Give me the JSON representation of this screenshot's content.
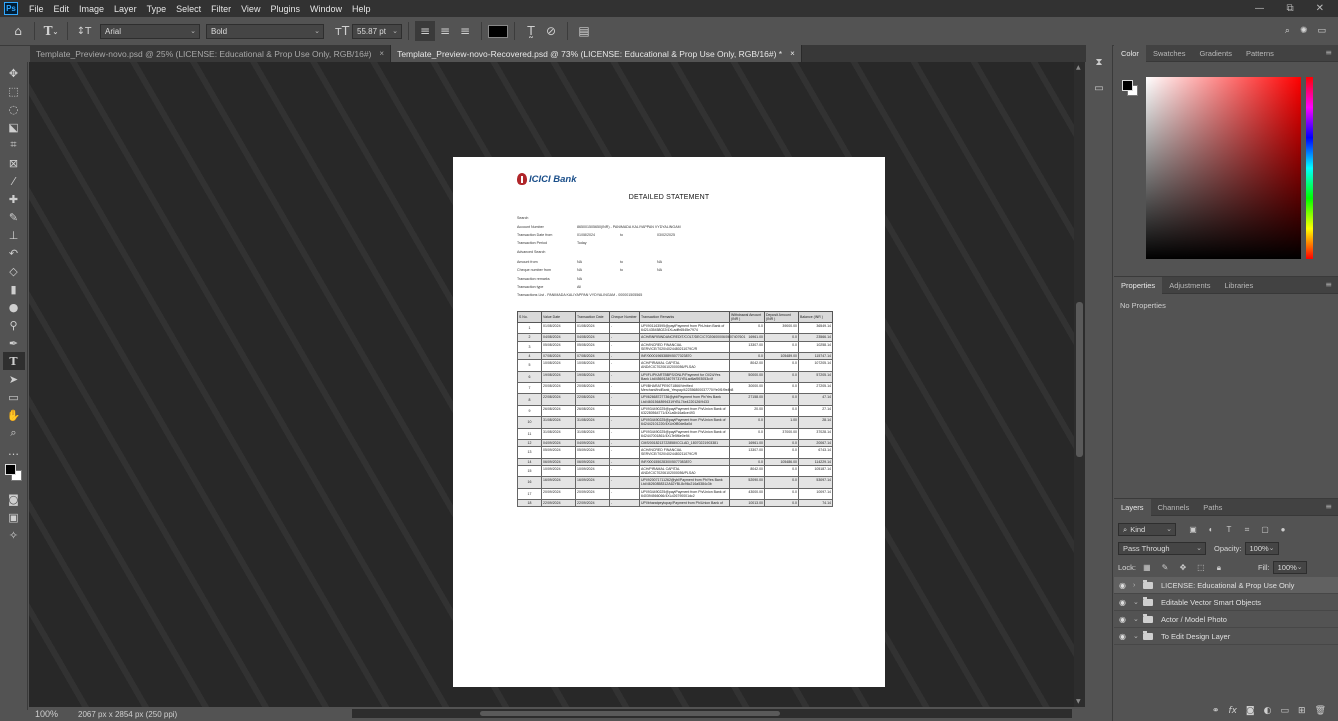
{
  "app": {
    "logo": "Ps"
  },
  "menu": [
    "File",
    "Edit",
    "Image",
    "Layer",
    "Type",
    "Select",
    "Filter",
    "View",
    "Plugins",
    "Window",
    "Help"
  ],
  "window_controls": {
    "minimize": "—",
    "restore": "⧉",
    "close": "✕"
  },
  "options": {
    "font_family": "Arial",
    "font_style": "Bold",
    "font_size": "55.87 pt",
    "text_color": "#000000"
  },
  "tabs": [
    {
      "label": "Template_Preview-novo.psd @ 25% (LICENSE: Educational & Prop Use Only, RGB/16#)",
      "close": "×"
    },
    {
      "label": "Template_Preview-novo-Recovered.psd @ 73% (LICENSE: Educational & Prop Use Only, RGB/16#) *",
      "close": "×"
    }
  ],
  "status": {
    "zoom": "100%",
    "doc_info": "2067 px x 2854 px (250 ppi)"
  },
  "document": {
    "bank_name": "ICICI Bank",
    "title": "DETAILED STATEMENT",
    "info_rows": [
      {
        "label": "Search",
        "value": "",
        "mid": "",
        "value2": ""
      },
      {
        "label": "Account Number",
        "value": "865001505650(INR) - PANIMADA KALIYAPPAN VYDYALINGAM",
        "mid": "",
        "value2": ""
      },
      {
        "label": "Transaction Date from",
        "value": "01/08/2024",
        "mid": "to",
        "value2": "03/02/2025"
      },
      {
        "label": "Transaction Period",
        "value": "Today",
        "mid": "",
        "value2": ""
      },
      {
        "label": "Advanced Search",
        "value": "",
        "mid": "",
        "value2": ""
      },
      {
        "label": "Amount from",
        "value": "NA",
        "mid": "to",
        "value2": "NA"
      },
      {
        "label": "Cheque number from",
        "value": "NA",
        "mid": "to",
        "value2": "NA"
      },
      {
        "label": "Transaction remarks",
        "value": "NA",
        "mid": "",
        "value2": ""
      },
      {
        "label": "Transaction type",
        "value": "All",
        "mid": "",
        "value2": ""
      },
      {
        "label": "Transactions List - PANIMADA KALIYAPPAN VYDYALINGAM - 000001505565",
        "value": "",
        "mid": "",
        "value2": ""
      }
    ],
    "table_headers": [
      "S No.",
      "Value Date",
      "Transaction Date",
      "Cheque Number",
      "Transaction Remarks",
      "Withdrawal Amount (INR )",
      "Deposit Amount (INR )",
      "Balance (INR )"
    ],
    "rows": [
      [
        "1",
        "01/08/2024",
        "01/08/2024",
        "-",
        "UPI/901163595@paytPayment from PhUnion Bank of 6421435458022/4XLadfb6545e7974",
        "0.0",
        "39000.00",
        "36549.14"
      ],
      [
        "2",
        "04/08/2024",
        "04/08/2024",
        "-",
        "ACH/BNFIBINDANCREDIT/COLT/DEC/C7020600006/0607407601",
        "16961.00",
        "0.0",
        "23566.14"
      ],
      [
        "3",
        "05/08/2024",
        "05/08/2024",
        "-",
        "ACH/INCRED FINANCIAL SERVICE/7020/4024480211079C/R",
        "13307.00",
        "0.0",
        "10258.14"
      ],
      [
        "4",
        "07/08/2024",
        "07/08/2024",
        "-",
        "INF/000019653889/5077023870",
        "0.0",
        "105489.00",
        "115747.14"
      ],
      [
        "5",
        "10/08/2024",
        "10/08/2024",
        "-",
        "ACH/PIRAMAL CAPITAL AND/ICIC70206102000056/PLSA0",
        "8042.00",
        "0.0",
        "107205.14"
      ],
      [
        "6",
        "19/08/2024",
        "19/08/2024",
        "-",
        "UPI/FLIPKARTBBPS/ONLP/Payment for OI/24/Yes Bank Ltd/4569134079731YBLad6af593053c4f",
        "50000.00",
        "0.0",
        "57205.14"
      ],
      [
        "7",
        "20/08/2024",
        "20/08/2024",
        "-",
        "UPI/BHARATPE9071866/Verified Merchant/IndBank_Yespay/422356800037770/Ye0f1f9e4b8",
        "30000.00",
        "0.0",
        "27205.14"
      ],
      [
        "8",
        "22/08/2024",
        "22/08/2024",
        "-",
        "UPI/62668727736@ybl/Payment from Ph/Yes Bank Ltd/46015648994319YBL74e4220126/9433",
        "27158.00",
        "0.0",
        "47.14"
      ],
      [
        "9",
        "26/08/2024",
        "26/08/2024",
        "-",
        "UPI/934490225@paytPayment from Ph/Union Bank of 632280564771/4XLa6b16a6ce493",
        "20.00",
        "0.0",
        "27.14"
      ],
      [
        "10",
        "31/08/2024",
        "31/08/2024",
        "-",
        "UPI/934490225@paytPayment from Ph/Union Bank of 642442101220/4XLb0f80de8a0d",
        "0.0",
        "1.00",
        "28.14"
      ],
      [
        "11",
        "31/08/2024",
        "31/08/2024",
        "-",
        "UPI/934490225@paytPayment from Ph/Union Bank of 642447001861/4XLTe5f6e0e94",
        "0.0",
        "37000.00",
        "37028.14"
      ],
      [
        "12",
        "04/09/2024",
        "04/09/2024",
        "-",
        "CMS/0018213722858/ICCLAD_18070221903381",
        "16961.00",
        "0.0",
        "20067.14"
      ],
      [
        "13",
        "05/09/2024",
        "05/09/2024",
        "-",
        "ACH/INCRED FINANCIAL SERVICE/7020/4024480211079C/R",
        "13307.00",
        "0.0",
        "6743.14"
      ],
      [
        "14",
        "06/09/2024",
        "06/09/2024",
        "-",
        "INF/000155028300/5077083870",
        "0.0",
        "105486.00",
        "114229.14"
      ],
      [
        "15",
        "10/09/2024",
        "10/09/2024",
        "-",
        "ACH/PIRAMAL CAPITAL AND/ICIC70206102000056/PLSA0",
        "8042.00",
        "0.0",
        "105187.14"
      ],
      [
        "16",
        "16/09/2024",
        "16/09/2024",
        "-",
        "UPI/920071711262@ybl/Payment from Ph/Yes Bank Ltd/46260858312A62YBL8c96c216a5384c3b",
        "52090.00",
        "0.0",
        "53097.14"
      ],
      [
        "17",
        "20/09/2024",
        "20/09/2024",
        "-",
        "UPI/934490225@paytPayment from Ph/Union Bank of 640394566066/4XLd26790001dc2",
        "43000.00",
        "0.0",
        "10097.14"
      ],
      [
        "18",
        "22/09/2024",
        "22/09/2024",
        "-",
        "UPI/bharatpeytopay/Payment from Ph/Union Bank of",
        "10013.00",
        "0.0",
        "74.14"
      ]
    ]
  },
  "panels": {
    "color_tabs": [
      "Color",
      "Swatches",
      "Gradients",
      "Patterns"
    ],
    "properties_tabs": [
      "Properties",
      "Adjustments",
      "Libraries"
    ],
    "properties_empty": "No Properties",
    "layers_tabs": [
      "Layers",
      "Channels",
      "Paths"
    ],
    "kind_label": "Kind",
    "blend_mode": "Pass Through",
    "opacity_label": "Opacity:",
    "opacity_value": "100%",
    "lock_label": "Lock:",
    "fill_label": "Fill:",
    "fill_value": "100%",
    "layers": [
      {
        "name": "LICENSE: Educational & Prop Use Only",
        "chev": "›"
      },
      {
        "name": "Editable Vector Smart Objects",
        "chev": "⌄"
      },
      {
        "name": "Actor / Model Photo",
        "chev": "⌄"
      },
      {
        "name": "To Edit Design Layer",
        "chev": "⌄"
      }
    ]
  }
}
